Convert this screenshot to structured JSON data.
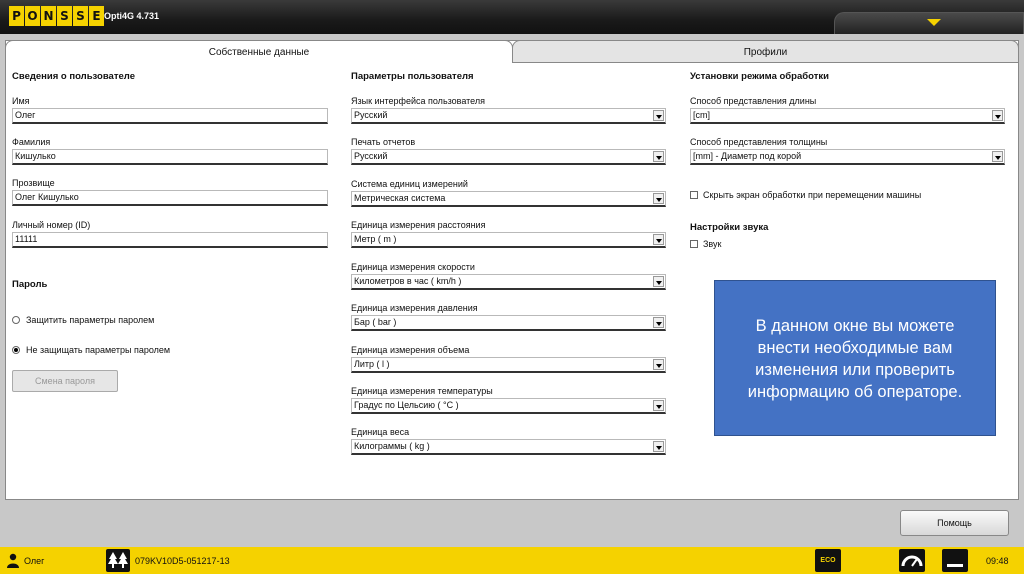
{
  "app": {
    "logo_letters": [
      "P",
      "O",
      "N",
      "S",
      "S",
      "E"
    ],
    "title": "Opti4G 4.731"
  },
  "tabs": [
    {
      "label": "Собственные данные",
      "active": true
    },
    {
      "label": "Профили",
      "active": false
    }
  ],
  "user_info": {
    "header": "Сведения о пользователе",
    "fields": [
      {
        "label": "Имя",
        "value": "Олег"
      },
      {
        "label": "Фамилия",
        "value": "Кишулько"
      },
      {
        "label": "Прозвище",
        "value": "Олег Кишулько"
      },
      {
        "label": "Личный номер (ID)",
        "value": "11111"
      }
    ]
  },
  "password": {
    "header": "Пароль",
    "options": [
      {
        "label": "Защитить параметры паролем",
        "selected": false
      },
      {
        "label": "Не защищать параметры паролем",
        "selected": true
      }
    ],
    "change_button": "Смена пароля"
  },
  "user_params": {
    "header": "Параметры пользователя",
    "selects": [
      {
        "label": "Язык интерфейса пользователя",
        "value": "Русский"
      },
      {
        "label": "Печать отчетов",
        "value": "Русский"
      },
      {
        "label": "Система единиц измерений",
        "value": "Метрическая система"
      },
      {
        "label": "Единица измерения расстояния",
        "value": "Метр ( m )"
      },
      {
        "label": "Единица измерения скорости",
        "value": "Километров в час ( km/h )"
      },
      {
        "label": "Единица измерения давления",
        "value": "Бар ( bar )"
      },
      {
        "label": "Единица измерения объема",
        "value": "Литр ( l )"
      },
      {
        "label": "Единица измерения температуры",
        "value": "Градус по Цельсию ( °C )"
      },
      {
        "label": "Единица веса",
        "value": "Килограммы ( kg )"
      }
    ]
  },
  "processing": {
    "header": "Установки режима обработки",
    "selects": [
      {
        "label": "Способ представления длины",
        "value": "[cm]"
      },
      {
        "label": "Способ представления толщины",
        "value": "[mm] - Диаметр под корой"
      }
    ],
    "hide_screen_checkbox": "Скрыть экран обработки при перемещении машины"
  },
  "sound": {
    "header": "Настройки звука",
    "checkbox": "Звук"
  },
  "info_box": {
    "lines": [
      "В данном окне вы можете",
      "внести необходимые вам",
      "изменения или проверить",
      "информацию об операторе."
    ],
    "color": "#4472c4"
  },
  "help_button": "Помощь",
  "status_bar": {
    "user": "Олег",
    "machine_id": "079KV10D5-051217-13",
    "eco_label": "ECO",
    "time": "09:48",
    "accent": "#f5d200"
  }
}
